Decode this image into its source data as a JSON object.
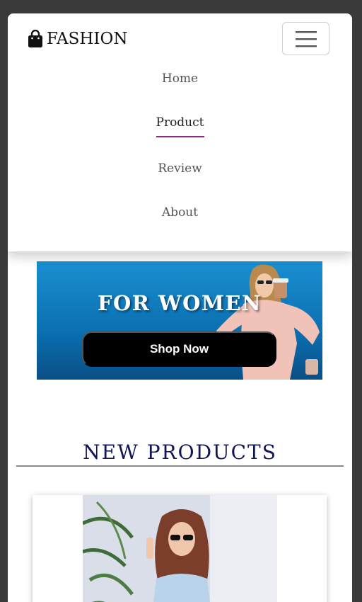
{
  "brand": {
    "name": "FASHION",
    "icon": "shopping-bag-icon"
  },
  "nav": {
    "toggle_icon": "hamburger-menu-icon",
    "items": [
      {
        "label": "Home",
        "active": false
      },
      {
        "label": "Product",
        "active": true
      },
      {
        "label": "Review",
        "active": false
      },
      {
        "label": "About",
        "active": false
      }
    ],
    "active_underline_color": "#8a2a8a"
  },
  "banner": {
    "title": "FOR WOMEN",
    "button_label": "Shop Now",
    "background_color": "#1a8fd0"
  },
  "section": {
    "title": "NEW PRODUCTS",
    "title_color": "#0f1555"
  }
}
